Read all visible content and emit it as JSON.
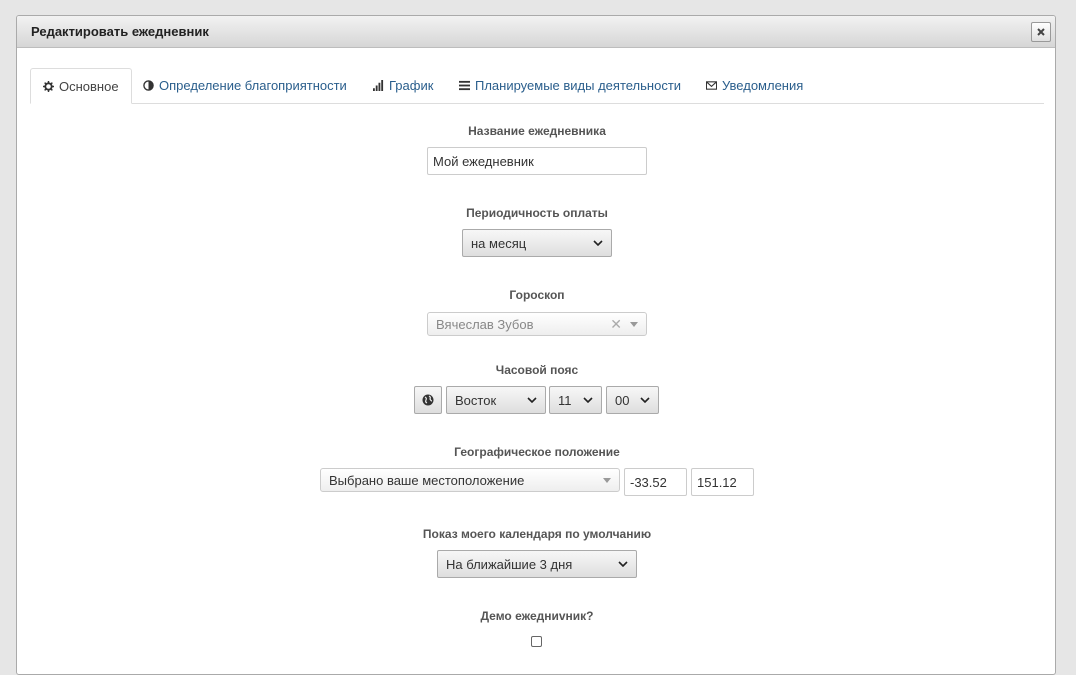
{
  "dialog": {
    "title": "Редактировать ежедневник",
    "close_icon": "close-icon"
  },
  "tabs": [
    {
      "label": "Основное",
      "icon": "gear-icon",
      "active": true
    },
    {
      "label": "Определение благоприятности",
      "icon": "half-circle-icon",
      "active": false
    },
    {
      "label": "График",
      "icon": "signal-bars-icon",
      "active": false
    },
    {
      "label": "Планируемые виды деятельности",
      "icon": "list-icon",
      "active": false
    },
    {
      "label": "Уведомления",
      "icon": "envelope-icon",
      "active": false
    }
  ],
  "form": {
    "name": {
      "label": "Название ежедневника",
      "value": "Мой ежедневник"
    },
    "payment": {
      "label": "Периодичность оплаты",
      "selected": "на месяц"
    },
    "horoscope": {
      "label": "Гороскоп",
      "selected": "Вячеслав Зубов"
    },
    "timezone": {
      "label": "Часовой пояс",
      "direction": "Восток",
      "hours": "11",
      "minutes": "00"
    },
    "location": {
      "label": "Географическое положение",
      "selected": "Выбрано ваше местоположение",
      "latitude": "-33.52",
      "longitude": "151.12"
    },
    "calendar_default": {
      "label": "Показ моего календаря по умолчанию",
      "selected": "На ближайшие 3 дня"
    },
    "demo": {
      "label": "Демо ежедниvник?",
      "checked": false
    }
  },
  "colors": {
    "link": "#2a5e8c",
    "titlebar": "#d6d6d6"
  }
}
